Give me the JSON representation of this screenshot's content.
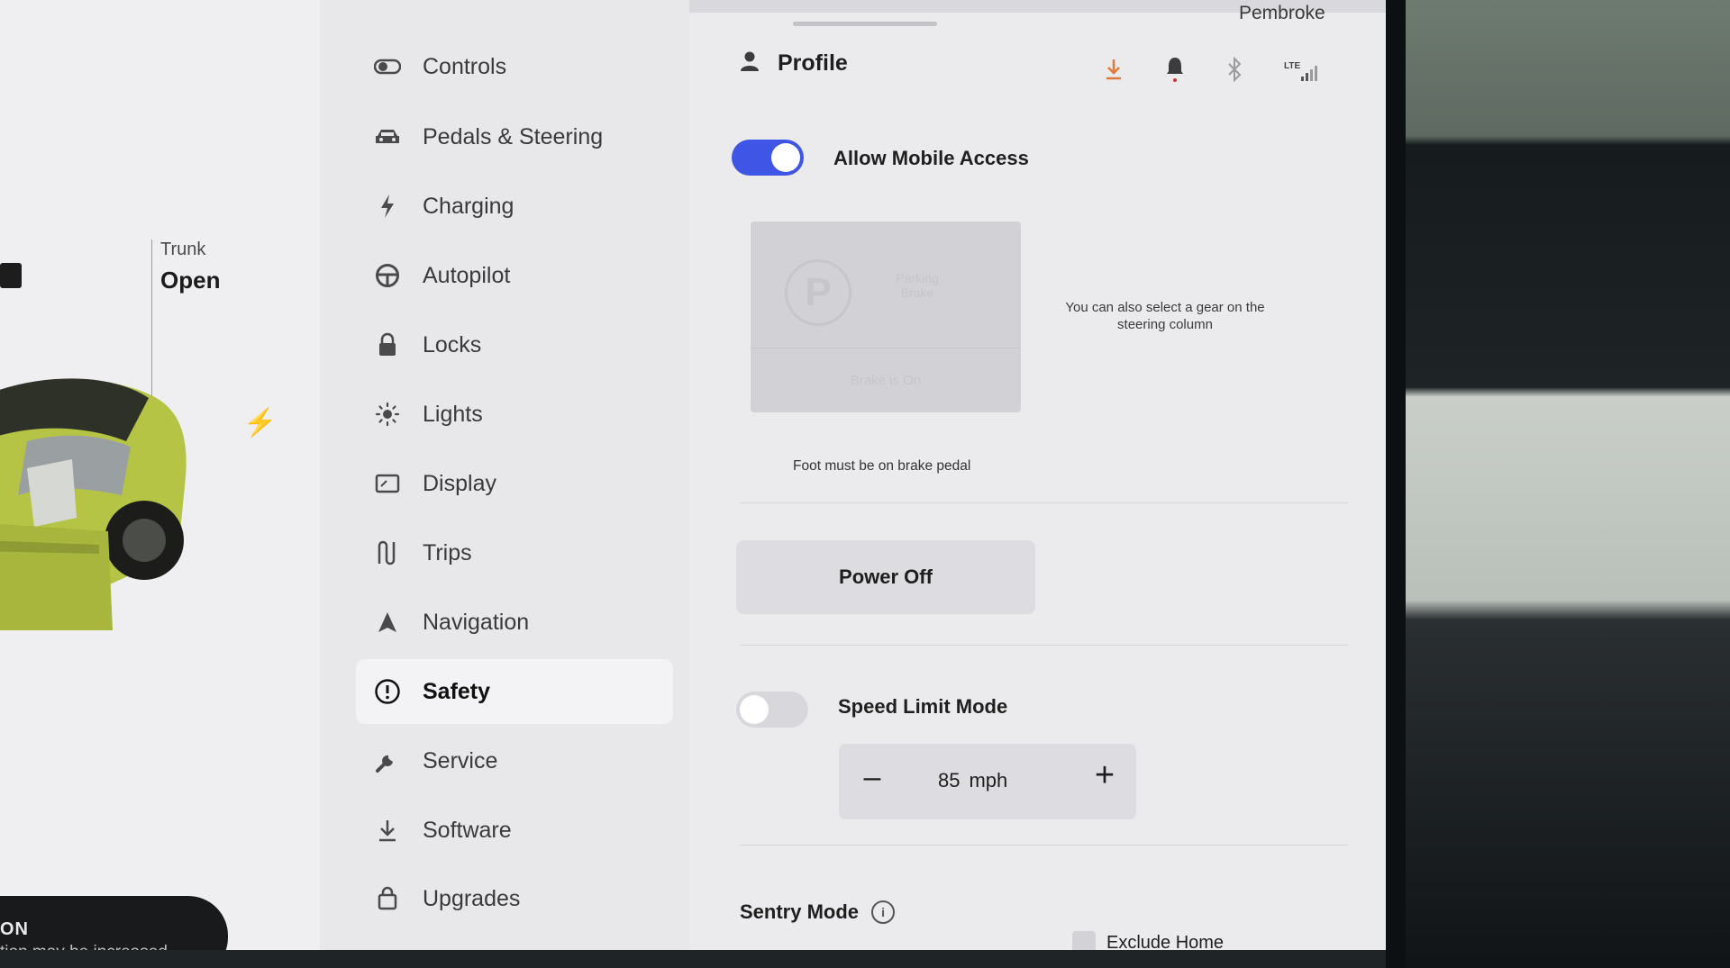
{
  "map": {
    "location": "Pembroke"
  },
  "car": {
    "trunk_label": "Trunk",
    "trunk_state": "Open",
    "notice_title": "ON",
    "notice_text": "tion may be increased",
    "paint_color": "#b6c445"
  },
  "menu": {
    "items": [
      {
        "label": "Controls",
        "icon": "toggle-icon"
      },
      {
        "label": "Pedals & Steering",
        "icon": "car-icon"
      },
      {
        "label": "Charging",
        "icon": "lightning-icon"
      },
      {
        "label": "Autopilot",
        "icon": "steering-wheel-icon"
      },
      {
        "label": "Locks",
        "icon": "lock-icon"
      },
      {
        "label": "Lights",
        "icon": "sun-icon"
      },
      {
        "label": "Display",
        "icon": "display-icon"
      },
      {
        "label": "Trips",
        "icon": "trips-icon"
      },
      {
        "label": "Navigation",
        "icon": "navigation-arrow-icon"
      },
      {
        "label": "Safety",
        "icon": "alert-circle-icon",
        "active": true
      },
      {
        "label": "Service",
        "icon": "wrench-icon"
      },
      {
        "label": "Software",
        "icon": "download-icon"
      },
      {
        "label": "Upgrades",
        "icon": "bag-icon"
      }
    ]
  },
  "header": {
    "profile_label": "Profile",
    "lte_label": "LTE"
  },
  "safety": {
    "allow_mobile_access_label": "Allow Mobile Access",
    "allow_mobile_access_on": true,
    "park_symbol": "P",
    "park_label": "Parking Brake",
    "brake_label": "Brake is On",
    "gear_note": "You can also select a gear on the steering column",
    "foot_note": "Foot must be on brake pedal",
    "power_off_label": "Power Off",
    "speed_limit_label": "Speed Limit Mode",
    "speed_limit_on": false,
    "speed_value": "85",
    "speed_unit": "mph",
    "minus_symbol": "–",
    "plus_symbol": "+",
    "sentry_label": "Sentry Mode",
    "info_symbol": "i",
    "exclude_home_label": "Exclude Home"
  },
  "colors": {
    "accent": "#3e55e6",
    "download_icon": "#e07a3a",
    "notification_dot": "#d33131"
  }
}
